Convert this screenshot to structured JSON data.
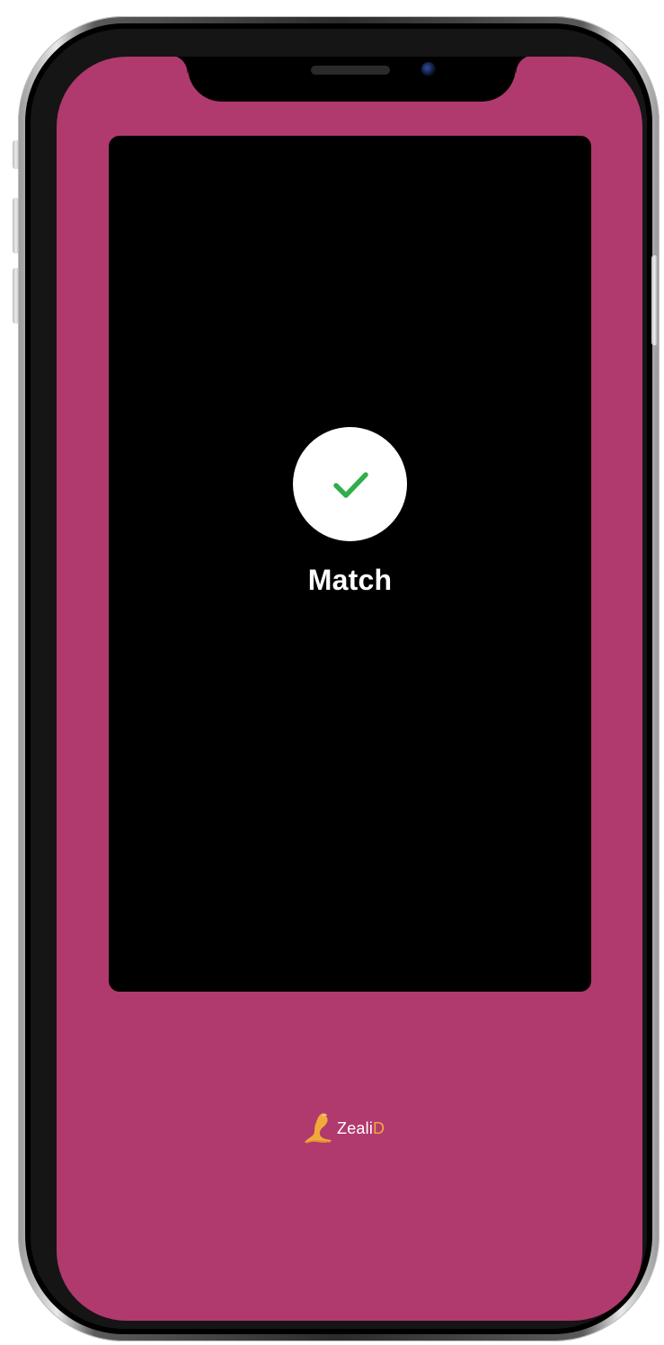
{
  "screen": {
    "background_color": "#b03a6d",
    "panel_color": "#000000",
    "status": {
      "label": "Match",
      "icon": "checkmark-icon",
      "check_color": "#2fae4a"
    }
  },
  "brand": {
    "name_part1": "Zeali",
    "name_part2": "D",
    "logo_icon": "seal-icon",
    "accent_color": "#f2a93b"
  }
}
